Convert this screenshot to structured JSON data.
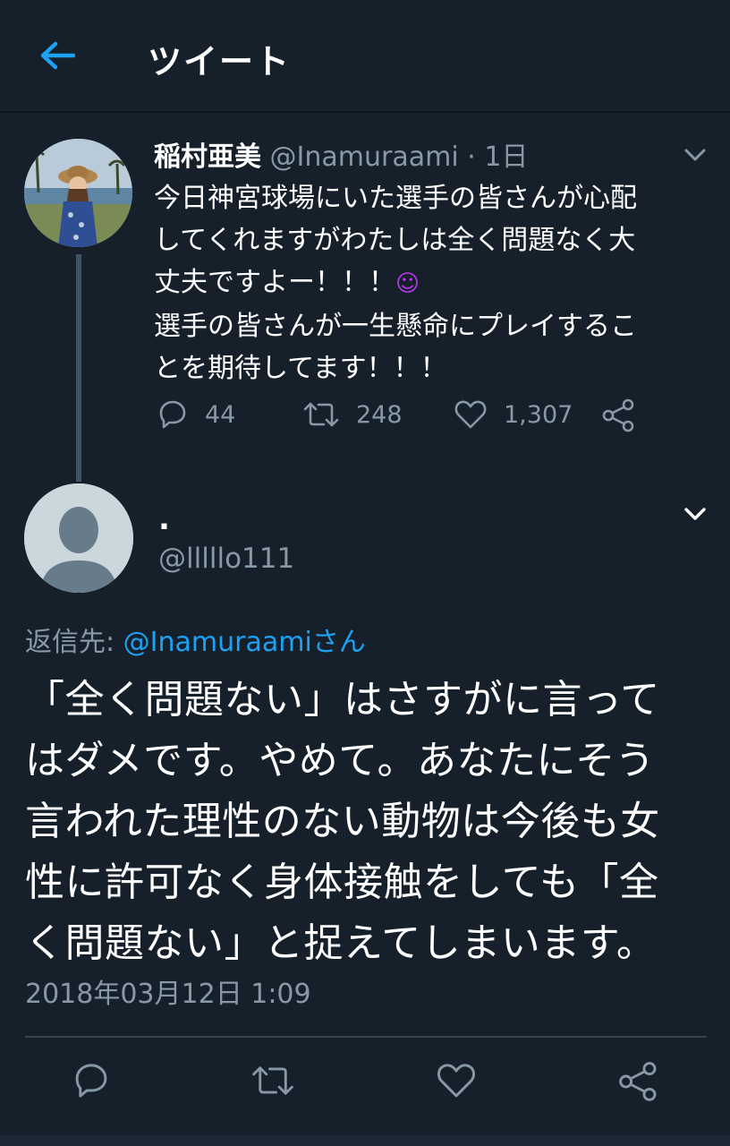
{
  "header": {
    "title": "ツイート"
  },
  "parent": {
    "name": "稲村亜美",
    "handle": "@Inamuraami",
    "separator": "·",
    "time": "1日",
    "lines": [
      "今日神宮球場にいた選手の皆さんが心配",
      "してくれますがわたしは全く問題なく大",
      "丈夫ですよー！！！",
      "選手の皆さんが一生懸命にプレイするこ",
      "とを期待してます！！！"
    ],
    "emoji": "☺",
    "replies": "44",
    "retweets": "248",
    "likes": "1,307"
  },
  "reply": {
    "name": ".",
    "handle": "@lllllo111",
    "reply_to_prefix": "返信先: ",
    "reply_to_user": "@Inamuraami",
    "reply_to_suffix": "さん",
    "lines": [
      "「全く問題ない」はさすがに言って",
      "はダメです。やめて。あなたにそう",
      "言われた理性のない動物は今後も女",
      "性に許可なく身体接触をしても「全",
      "く問題ない」と捉えてしまいます。"
    ],
    "timestamp": "2018年03月12日 1:09"
  },
  "colors": {
    "background": "#15202b",
    "muted": "#8899a6",
    "accent": "#1da1f2"
  }
}
